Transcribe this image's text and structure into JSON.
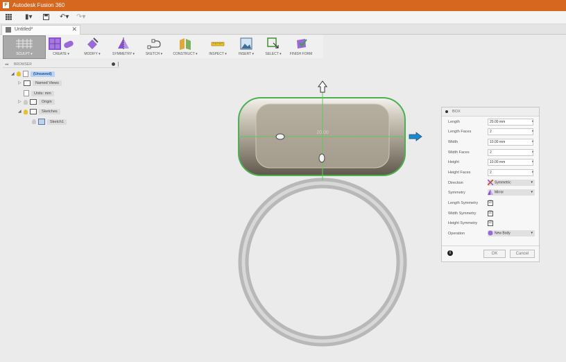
{
  "app": {
    "logo": "F",
    "title": "Autodesk Fusion 360",
    "accent": "#d5671f"
  },
  "qat": {
    "grid": "grid-icon",
    "file": "▮▾",
    "save": "save-icon",
    "undo": "↶▾",
    "redo": "↷▾"
  },
  "tab": {
    "label": "Untitled*",
    "close": "✕"
  },
  "toolbar": {
    "sculpt": "SCULPT ▾",
    "create": "CREATE ▾",
    "modify": "MODIFY ▾",
    "symmetry": "SYMMETRY ▾",
    "sketch": "SKETCH ▾",
    "construct": "CONSTRUCT ▾",
    "inspect": "INSPECT ▾",
    "insert": "INSERT ▾",
    "select": "SELECT ▾",
    "finish": "FINISH FORM"
  },
  "browser": {
    "title": "BROWSER",
    "collapse": "◂◂",
    "root": "(Unsaved)",
    "named_views": "Named Views",
    "units": "Units: mm",
    "origin": "Origin",
    "sketches": "Sketches",
    "sketch1": "Sketch1"
  },
  "viewport": {
    "dimension_label": "20.00",
    "box_color": "#8d8678",
    "ring_color": "#c4c4c4",
    "selection_color": "#4caf50",
    "arrow_color": "#1e88c8"
  },
  "panel": {
    "title": "BOX",
    "rows": [
      {
        "label": "Length",
        "value": "20.00 mm"
      },
      {
        "label": "Length Faces",
        "value": "2"
      },
      {
        "label": "Width",
        "value": "10.00 mm"
      },
      {
        "label": "Width Faces",
        "value": "2"
      },
      {
        "label": "Height",
        "value": "10.00 mm"
      },
      {
        "label": "Height Faces",
        "value": "2"
      }
    ],
    "direction": {
      "label": "Direction",
      "value": "Symmetric"
    },
    "symmetry": {
      "label": "Symmetry",
      "value": "Mirror"
    },
    "checks": [
      {
        "label": "Length Symmetry",
        "checked": "☑"
      },
      {
        "label": "Width Symmetry",
        "checked": "☑"
      },
      {
        "label": "Height Symmetry",
        "checked": "☑"
      }
    ],
    "operation": {
      "label": "Operation",
      "value": "New Body"
    },
    "info": "i",
    "ok": "OK",
    "cancel": "Cancel"
  }
}
